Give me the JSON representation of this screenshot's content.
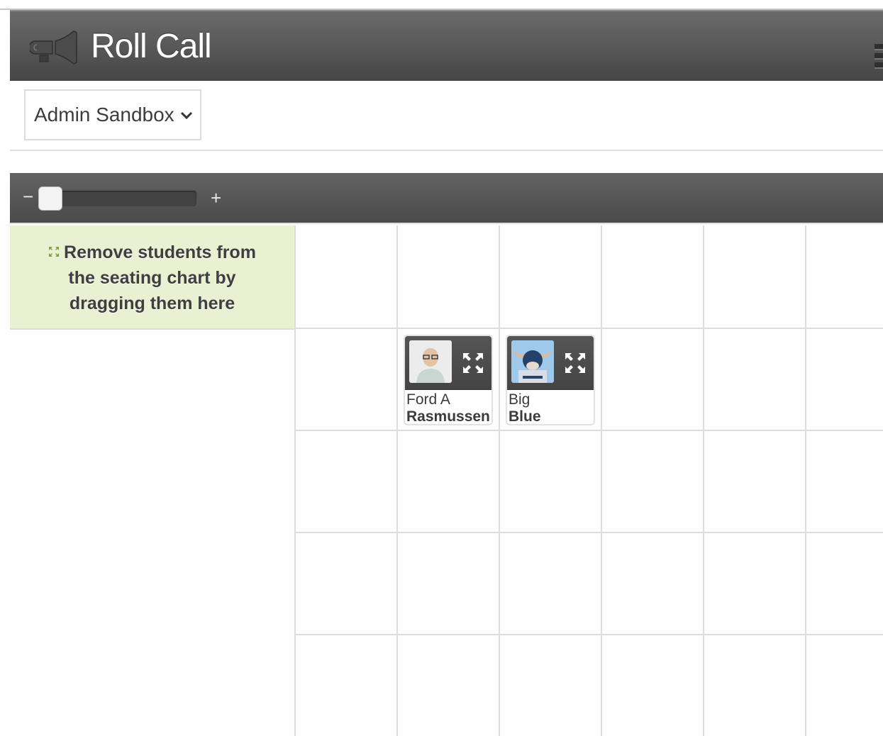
{
  "header": {
    "app_title": "Roll Call",
    "app_icon": "megaphone-icon",
    "menu_icon": "menu-icon"
  },
  "course_select": {
    "selected": "Admin Sandbox",
    "icon": "chevron-down-icon"
  },
  "zoom_control": {
    "minus_label": "−",
    "plus_label": "+",
    "value_percent": 0
  },
  "unseat_zone": {
    "icon": "move-icon",
    "text": "Remove students from the seating chart by dragging them here",
    "background": "#eaf0d2"
  },
  "seating_grid": {
    "visible_columns": 6,
    "visible_rows": 5,
    "students": [
      {
        "first_name": "Ford A",
        "last_name": "Rasmussen",
        "row": 2,
        "col": 2,
        "photo": "student-photo",
        "expand_icon": "expand-icon"
      },
      {
        "first_name": "Big",
        "last_name": "Blue",
        "row": 2,
        "col": 3,
        "photo": "mascot-photo",
        "expand_icon": "expand-icon"
      }
    ]
  },
  "colors": {
    "header_dark": "#474747",
    "header_light": "#6a6a6a",
    "grid_line": "#dddddd",
    "text_dark": "#3d3d3d"
  }
}
